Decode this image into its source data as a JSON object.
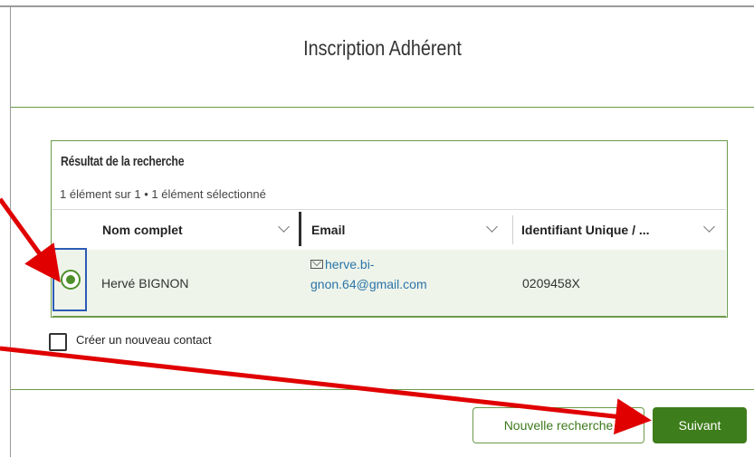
{
  "modal": {
    "title": "Inscription Adhérent"
  },
  "results": {
    "title": "Résultat de la recherche",
    "count_text": "1 élément sur 1 • 1 élément sélectionné",
    "columns": [
      "Nom complet",
      "Email",
      "Identifiant Unique / ..."
    ],
    "rows": [
      {
        "selected": true,
        "name": "Hervé BIGNON",
        "email_line1": "herve.bi-",
        "email_line2": "gnon.64@gmail.com",
        "identifier": "0209458X"
      }
    ]
  },
  "create_contact": {
    "label": "Créer un nouveau contact",
    "checked": false
  },
  "buttons": {
    "new_search": "Nouvelle recherche",
    "next": "Suivant"
  },
  "colors": {
    "accent_green": "#3e7d1c",
    "annotation_red": "#e00000",
    "selection_blue": "#2b5bb5"
  }
}
